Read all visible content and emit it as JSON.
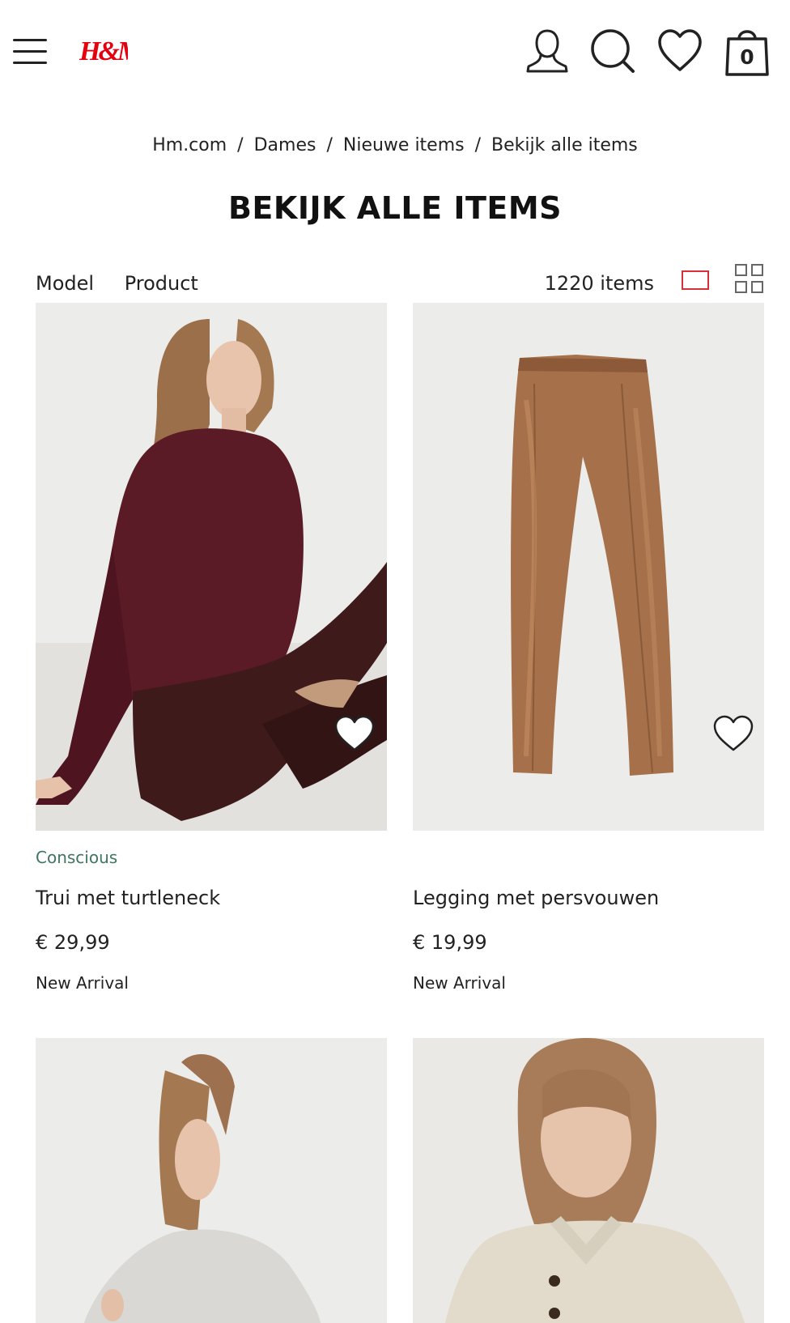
{
  "brand": {
    "logo_text": "H&M",
    "color": "#e50010"
  },
  "header": {
    "cart_count": "0"
  },
  "breadcrumb": [
    "Hm.com",
    "Dames",
    "Nieuwe items",
    "Bekijk alle items"
  ],
  "breadcrumb_separator": "/",
  "page_title": "BEKIJK ALLE ITEMS",
  "filters": [
    "Model",
    "Product"
  ],
  "item_count": "1220 items",
  "products": [
    {
      "tag": "Conscious",
      "name": "Trui met turtleneck",
      "price": "€ 29,99",
      "badge": "New Arrival",
      "favorite": false
    },
    {
      "tag": "",
      "name": "Legging met persvouwen",
      "price": "€ 19,99",
      "badge": "New Arrival",
      "favorite": false
    },
    {
      "tag": "",
      "name": "",
      "price": "",
      "badge": "",
      "favorite": false
    },
    {
      "tag": "",
      "name": "",
      "price": "",
      "badge": "",
      "favorite": false
    }
  ],
  "colors": {
    "accent": "#d8303a",
    "conscious": "#3f7660",
    "image_bg": "#ececea"
  },
  "icons": [
    "menu-icon",
    "user-icon",
    "search-icon",
    "heart-icon",
    "shopping-bag-icon",
    "single-view-icon",
    "grid-view-icon"
  ]
}
